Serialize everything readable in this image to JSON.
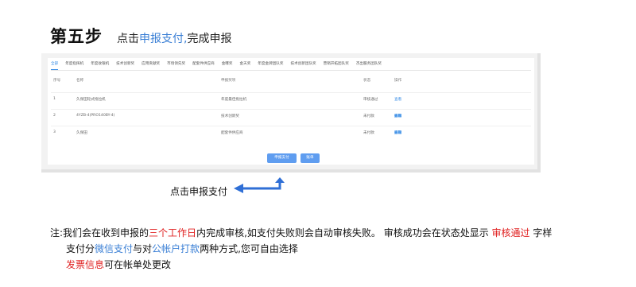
{
  "step": {
    "number": "第五步",
    "desc_prefix": "点击",
    "desc_highlight": "申报支付,",
    "desc_suffix": "完成申报"
  },
  "tabs": [
    {
      "label": "全部",
      "active": true
    },
    {
      "label": "年度指挥机"
    },
    {
      "label": "年度收银机"
    },
    {
      "label": "技术创新奖"
    },
    {
      "label": "应用贡献奖"
    },
    {
      "label": "市场领先奖"
    },
    {
      "label": "配套件供应商"
    },
    {
      "label": "金曝奖"
    },
    {
      "label": "金天奖"
    },
    {
      "label": "年度金牌团队奖"
    },
    {
      "label": "技术创新团队奖"
    },
    {
      "label": "营销开拓团队奖"
    },
    {
      "label": "杰出服务团队奖"
    }
  ],
  "table": {
    "headers": {
      "no": "序号",
      "name": "名称",
      "type": "申报奖项",
      "status": "状态",
      "op": "操作"
    },
    "rows": [
      {
        "no": "1",
        "name": "久保田轮式拖拉机",
        "type": "年度最佳拖拉机",
        "status": "审核通过",
        "ops": [
          "查看"
        ]
      },
      {
        "no": "2",
        "name": "4YZB-4(PRO140BY-4)",
        "type": "技术创新奖",
        "status": "未付款",
        "ops": [
          "查看",
          "编辑",
          "删除"
        ]
      },
      {
        "no": "3",
        "name": "久保田",
        "type": "配套件供应商",
        "status": "未付款",
        "ops": [
          "查看",
          "编辑",
          "删除"
        ]
      }
    ]
  },
  "buttons": {
    "pay": "申报支付",
    "bill": "账单"
  },
  "arrow_label": "点击申报支付",
  "notes": {
    "l1_prefix": "注:我们会在收到申报的",
    "l1_red": "三个工作日",
    "l1_mid": "内完成审核,如支付失败则会自动审核失败。 审核成功会在状态处显示 ",
    "l1_red2": "审核通过",
    "l1_suffix": " 字样",
    "l2_prefix": "支付分",
    "l2_blue1": "微信支付",
    "l2_mid": "与对",
    "l2_blue2": "公帐户打款",
    "l2_suffix": "两种方式,您可自由选择",
    "l3_red": "发票信息",
    "l3_suffix": "可在帐单处更改"
  },
  "colors": {
    "accent": "#3a8ee6",
    "button": "#5f9df0",
    "red": "#e02020"
  }
}
